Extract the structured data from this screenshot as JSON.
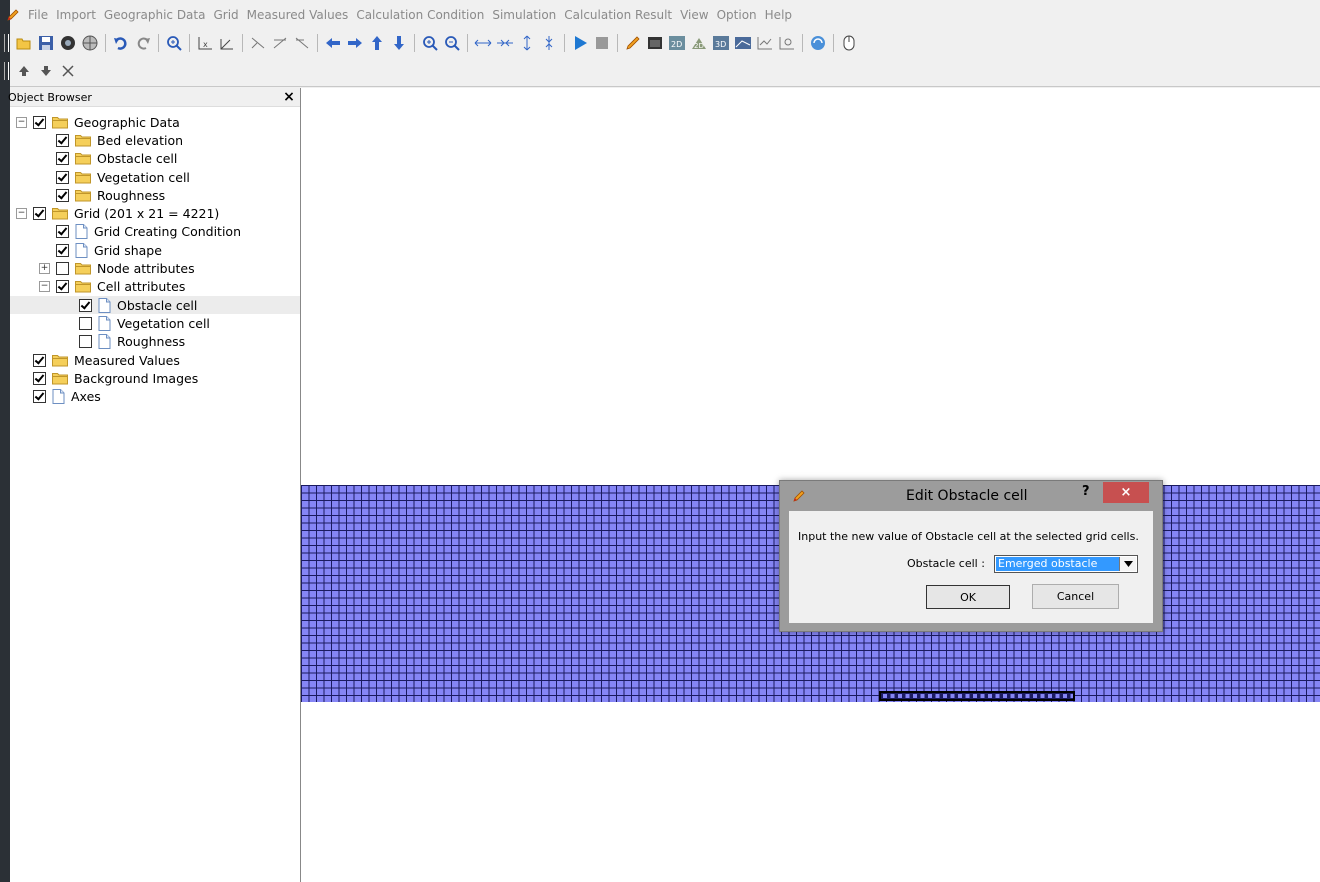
{
  "menu": [
    "File",
    "Import",
    "Geographic Data",
    "Grid",
    "Measured Values",
    "Calculation Condition",
    "Simulation",
    "Calculation Result",
    "View",
    "Option",
    "Help"
  ],
  "object_browser": {
    "title": "Object Browser",
    "tree": [
      {
        "label": "Geographic Data",
        "checked": true,
        "icon": "folder-icon",
        "indent": 0,
        "expander": "minus"
      },
      {
        "label": "Bed elevation",
        "checked": true,
        "icon": "folder-icon",
        "indent": 1
      },
      {
        "label": "Obstacle cell",
        "checked": true,
        "icon": "folder-icon",
        "indent": 1
      },
      {
        "label": "Vegetation cell",
        "checked": true,
        "icon": "folder-icon",
        "indent": 1
      },
      {
        "label": "Roughness",
        "checked": true,
        "icon": "folder-icon",
        "indent": 1
      },
      {
        "label": "Grid (201 x 21 = 4221)",
        "checked": true,
        "icon": "folder-icon",
        "indent": 0,
        "expander": "minus"
      },
      {
        "label": "Grid Creating Condition",
        "checked": true,
        "icon": "document-icon",
        "indent": 1
      },
      {
        "label": "Grid shape",
        "checked": true,
        "icon": "document-icon",
        "indent": 1
      },
      {
        "label": "Node attributes",
        "checked": false,
        "icon": "folder-icon",
        "indent": 1,
        "expander": "plus"
      },
      {
        "label": "Cell attributes",
        "checked": true,
        "icon": "folder-icon",
        "indent": 1,
        "expander": "minus"
      },
      {
        "label": "Obstacle cell",
        "checked": true,
        "icon": "document-icon",
        "indent": 2,
        "selected": true
      },
      {
        "label": "Vegetation cell",
        "checked": false,
        "icon": "document-icon",
        "indent": 2
      },
      {
        "label": "Roughness",
        "checked": false,
        "icon": "document-icon",
        "indent": 2
      },
      {
        "label": "Measured Values",
        "checked": true,
        "icon": "folder-icon",
        "indent": 0
      },
      {
        "label": "Background Images",
        "checked": true,
        "icon": "folder-icon",
        "indent": 0
      },
      {
        "label": "Axes",
        "checked": true,
        "icon": "document-icon",
        "indent": 0
      }
    ]
  },
  "dialog": {
    "title": "Edit Obstacle cell",
    "help": "?",
    "close": "×",
    "message": "Input the new value of Obstacle cell at the selected grid cells.",
    "field_label": "Obstacle cell :",
    "field_value": "Emerged obstacle",
    "ok": "OK",
    "cancel": "Cancel"
  },
  "colors": {
    "grid_fill": "#8585f5",
    "grid_lines": "#1a1a60",
    "selection": "#3399ff",
    "close_button": "#c75050"
  }
}
